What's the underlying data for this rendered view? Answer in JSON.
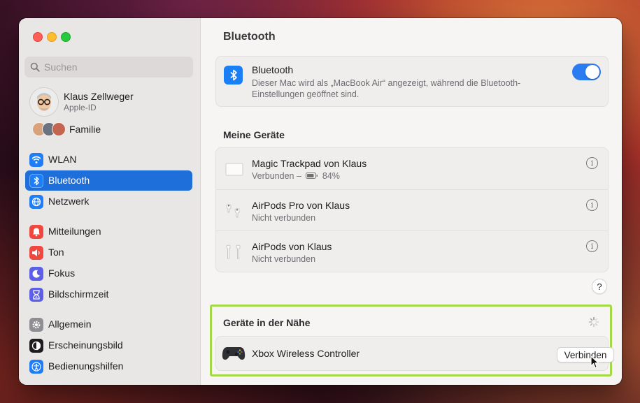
{
  "search": {
    "placeholder": "Suchen"
  },
  "profile": {
    "name": "Klaus Zellweger",
    "subtitle": "Apple-ID"
  },
  "family": {
    "label": "Familie"
  },
  "sidebar": {
    "items": [
      {
        "label": "WLAN",
        "icon": "wifi-icon",
        "color": "#1f7ef6"
      },
      {
        "label": "Bluetooth",
        "icon": "bluetooth-icon",
        "color": "#1f7ef6"
      },
      {
        "label": "Netzwerk",
        "icon": "globe-icon",
        "color": "#1f7ef6"
      },
      {
        "label": "Mitteilungen",
        "icon": "bell-icon",
        "color": "#f0473e"
      },
      {
        "label": "Ton",
        "icon": "speaker-icon",
        "color": "#f0473e"
      },
      {
        "label": "Fokus",
        "icon": "moon-icon",
        "color": "#5d5fe6"
      },
      {
        "label": "Bildschirmzeit",
        "icon": "hourglass-icon",
        "color": "#5d5fe6"
      },
      {
        "label": "Allgemein",
        "icon": "gear-icon",
        "color": "#8e8e93"
      },
      {
        "label": "Erscheinungsbild",
        "icon": "appearance-icon",
        "color": "#1d1d1f"
      },
      {
        "label": "Bedienungshilfen",
        "icon": "accessibility-icon",
        "color": "#1f7ef6"
      }
    ],
    "selected": "Bluetooth"
  },
  "main": {
    "title": "Bluetooth",
    "bluetooth": {
      "title": "Bluetooth",
      "description": "Dieser Mac wird als „MacBook Air“ angezeigt, während die Bluetooth-Einstellungen geöffnet sind.",
      "enabled": true
    },
    "my_devices": {
      "title": "Meine Geräte",
      "devices": [
        {
          "name": "Magic Trackpad von Klaus",
          "status": "Verbunden –",
          "battery": "84%",
          "icon": "trackpad-icon"
        },
        {
          "name": "AirPods Pro von Klaus",
          "status": "Nicht verbunden",
          "icon": "airpods-pro-icon"
        },
        {
          "name": "AirPods von Klaus",
          "status": "Nicht verbunden",
          "icon": "airpods-icon"
        }
      ]
    },
    "help_label": "?",
    "nearby": {
      "title": "Geräte in der Nähe",
      "devices": [
        {
          "name": "Xbox Wireless Controller",
          "action": "Verbinden",
          "icon": "gamepad-icon"
        }
      ]
    }
  },
  "colors": {
    "accent": "#1f6fdb",
    "highlight": "#a6d94a"
  }
}
